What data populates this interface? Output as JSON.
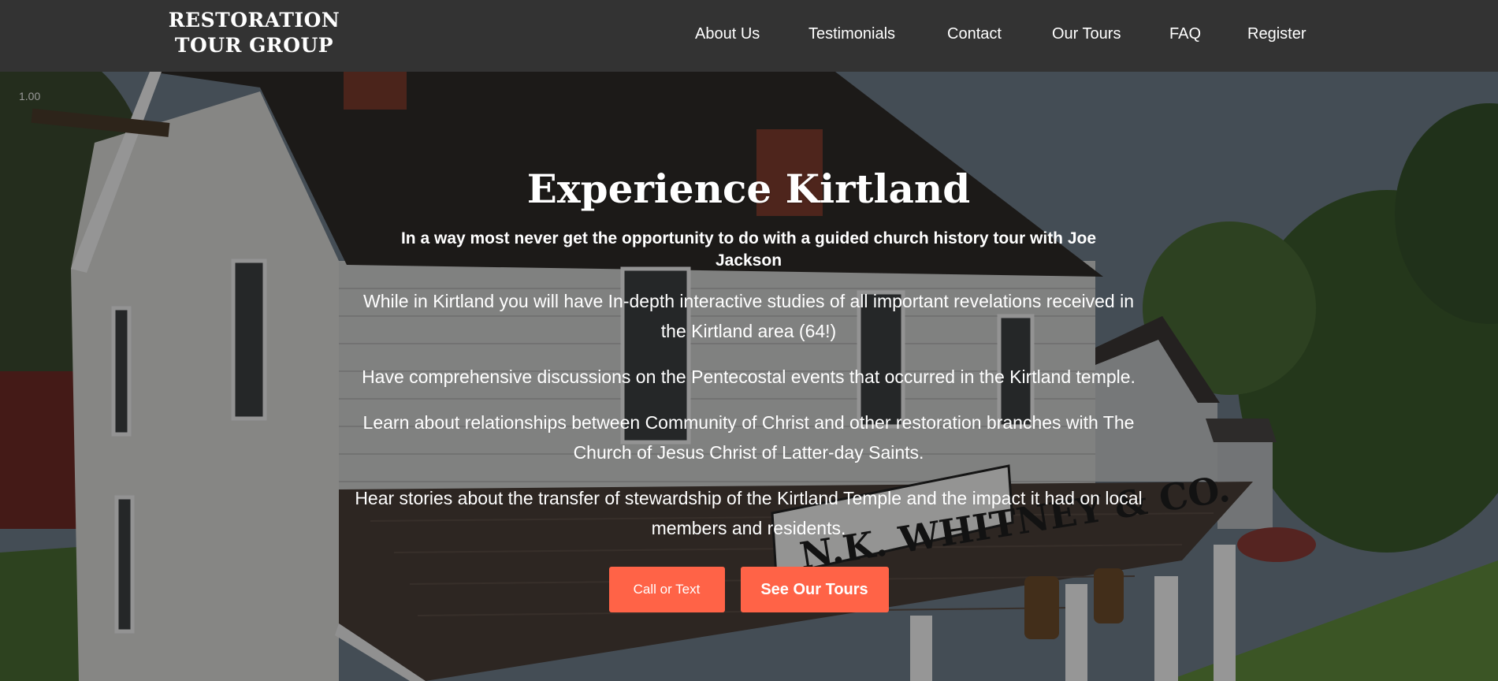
{
  "logo": {
    "line1": "RESTORATION",
    "line2": "TOUR GROUP"
  },
  "nav": {
    "items": [
      {
        "label": "About Us"
      },
      {
        "label": "Testimonials"
      },
      {
        "label": "Contact"
      },
      {
        "label": "Our Tours"
      },
      {
        "label": "FAQ"
      },
      {
        "label": "Register"
      }
    ]
  },
  "hero": {
    "playback_speed": "1.00",
    "title": "Experience Kirtland",
    "subtitle": "In a way most never get the opportunity to do with a guided church history tour with Joe Jackson",
    "paragraphs": [
      "While in Kirtland you will have In-depth interactive studies of all important revelations received in the Kirtland area (64!)",
      "Have comprehensive discussions on the Pentecostal events that occurred in the Kirtland temple.",
      "Learn about relationships between Community of Christ and other restoration branches with The Church of Jesus Christ of Latter-day Saints.",
      "Hear stories about the transfer of stewardship of the Kirtland Temple and the impact it had on local members and residents."
    ],
    "buttons": {
      "call": "Call or Text",
      "tours": "See Our Tours"
    },
    "background_sign_text": "N.K. WHITNEY & CO."
  },
  "colors": {
    "nav_bg": "#333333",
    "accent": "#ff6347"
  }
}
